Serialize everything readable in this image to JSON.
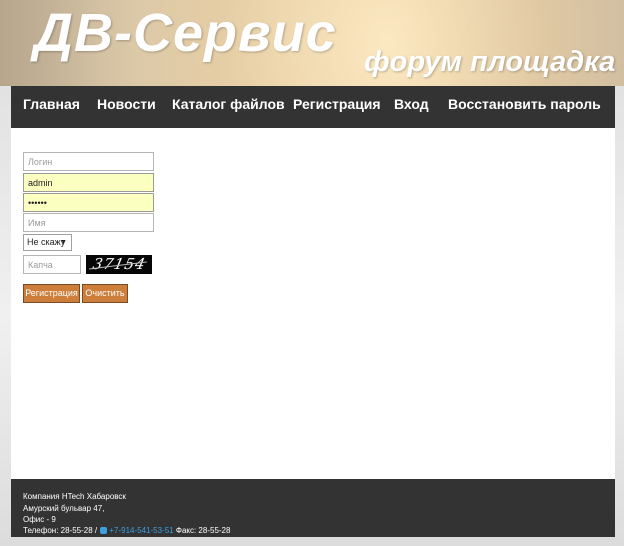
{
  "banner": {
    "title": "ДВ-Сервис",
    "subtitle": "форум площадка"
  },
  "nav": {
    "items": [
      {
        "label": "Главная"
      },
      {
        "label": "Новости"
      },
      {
        "label": "Каталог файлов"
      },
      {
        "label": "Регистрация"
      },
      {
        "label": "Вход"
      },
      {
        "label": "Восстановить пароль"
      }
    ]
  },
  "form": {
    "login_placeholder": "Логин",
    "email_value": "admin",
    "password_value": "••••••",
    "name_placeholder": "Имя",
    "gender_selected": "Не скажу",
    "captcha_placeholder": "Капча",
    "captcha_code": "37154",
    "register_label": "Регистрация",
    "clear_label": "Очистить"
  },
  "footer": {
    "company": "Компания HTech Хабаровск",
    "address": "Амурский бульвар 47,",
    "office": "Офис - 9",
    "phone_label": "Телефон: 28-55-28 /",
    "mobile": "+7-914-541-53-51",
    "fax": "Факс: 28-55-28"
  },
  "colors": {
    "nav_bg": "#333333",
    "button_bg": "#cd7e3a",
    "autofill_bg": "#fbffc0",
    "link": "#3aa0e0"
  }
}
